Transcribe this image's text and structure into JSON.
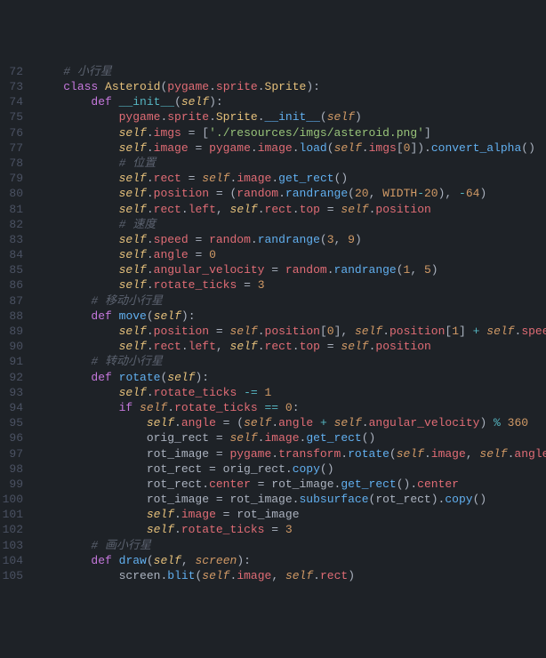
{
  "startLine": 72,
  "lines": [
    [
      [
        "    ",
        ""
      ],
      [
        "# 小行星",
        "c-comment"
      ]
    ],
    [
      [
        "    ",
        ""
      ],
      [
        "class ",
        "c-keyword"
      ],
      [
        "Asteroid",
        "c-class"
      ],
      [
        "(",
        "c-punct"
      ],
      [
        "pygame",
        "c-prop"
      ],
      [
        ".",
        "c-punct"
      ],
      [
        "sprite",
        "c-prop"
      ],
      [
        ".",
        "c-punct"
      ],
      [
        "Sprite",
        "c-class"
      ],
      [
        "):",
        "c-punct"
      ]
    ],
    [
      [
        "        ",
        ""
      ],
      [
        "def ",
        "c-keyword"
      ],
      [
        "__init__",
        "c-special"
      ],
      [
        "(",
        "c-punct"
      ],
      [
        "self",
        "c-self"
      ],
      [
        "):",
        "c-punct"
      ]
    ],
    [
      [
        "            ",
        ""
      ],
      [
        "pygame",
        "c-prop"
      ],
      [
        ".",
        "c-punct"
      ],
      [
        "sprite",
        "c-prop"
      ],
      [
        ".",
        "c-punct"
      ],
      [
        "Sprite",
        "c-class"
      ],
      [
        ".",
        "c-punct"
      ],
      [
        "__init__",
        "c-func"
      ],
      [
        "(",
        "c-punct"
      ],
      [
        "self",
        "c-param"
      ],
      [
        ")",
        "c-punct"
      ]
    ],
    [
      [
        "            ",
        ""
      ],
      [
        "self",
        "c-self"
      ],
      [
        ".",
        "c-punct"
      ],
      [
        "imgs",
        "c-prop"
      ],
      [
        " = ",
        "c-punct"
      ],
      [
        "[",
        "c-punct"
      ],
      [
        "'./resources/imgs/asteroid.png'",
        "c-string"
      ],
      [
        "]",
        "c-punct"
      ]
    ],
    [
      [
        "            ",
        ""
      ],
      [
        "self",
        "c-self"
      ],
      [
        ".",
        "c-punct"
      ],
      [
        "image",
        "c-prop"
      ],
      [
        " = ",
        "c-punct"
      ],
      [
        "pygame",
        "c-prop"
      ],
      [
        ".",
        "c-punct"
      ],
      [
        "image",
        "c-prop"
      ],
      [
        ".",
        "c-punct"
      ],
      [
        "load",
        "c-func"
      ],
      [
        "(",
        "c-punct"
      ],
      [
        "self",
        "c-param"
      ],
      [
        ".",
        "c-punct"
      ],
      [
        "imgs",
        "c-prop"
      ],
      [
        "[",
        "c-punct"
      ],
      [
        "0",
        "c-num"
      ],
      [
        "]).",
        "c-punct"
      ],
      [
        "convert_alpha",
        "c-func"
      ],
      [
        "()",
        "c-punct"
      ]
    ],
    [
      [
        "            ",
        ""
      ],
      [
        "# 位置",
        "c-comment"
      ]
    ],
    [
      [
        "            ",
        ""
      ],
      [
        "self",
        "c-self"
      ],
      [
        ".",
        "c-punct"
      ],
      [
        "rect",
        "c-prop"
      ],
      [
        " = ",
        "c-punct"
      ],
      [
        "self",
        "c-param"
      ],
      [
        ".",
        "c-punct"
      ],
      [
        "image",
        "c-prop"
      ],
      [
        ".",
        "c-punct"
      ],
      [
        "get_rect",
        "c-func"
      ],
      [
        "()",
        "c-punct"
      ]
    ],
    [
      [
        "            ",
        ""
      ],
      [
        "self",
        "c-self"
      ],
      [
        ".",
        "c-punct"
      ],
      [
        "position",
        "c-prop"
      ],
      [
        " = (",
        "c-punct"
      ],
      [
        "random",
        "c-prop"
      ],
      [
        ".",
        "c-punct"
      ],
      [
        "randrange",
        "c-func"
      ],
      [
        "(",
        "c-punct"
      ],
      [
        "20",
        "c-num"
      ],
      [
        ", ",
        "c-punct"
      ],
      [
        "WIDTH",
        "c-const"
      ],
      [
        "-",
        "c-op"
      ],
      [
        "20",
        "c-num"
      ],
      [
        "), ",
        "c-punct"
      ],
      [
        "-",
        "c-op"
      ],
      [
        "64",
        "c-num"
      ],
      [
        ")",
        "c-punct"
      ]
    ],
    [
      [
        "            ",
        ""
      ],
      [
        "self",
        "c-self"
      ],
      [
        ".",
        "c-punct"
      ],
      [
        "rect",
        "c-prop"
      ],
      [
        ".",
        "c-punct"
      ],
      [
        "left",
        "c-prop"
      ],
      [
        ", ",
        "c-punct"
      ],
      [
        "self",
        "c-self"
      ],
      [
        ".",
        "c-punct"
      ],
      [
        "rect",
        "c-prop"
      ],
      [
        ".",
        "c-punct"
      ],
      [
        "top",
        "c-prop"
      ],
      [
        " = ",
        "c-punct"
      ],
      [
        "self",
        "c-param"
      ],
      [
        ".",
        "c-punct"
      ],
      [
        "position",
        "c-prop"
      ]
    ],
    [
      [
        "            ",
        ""
      ],
      [
        "# 速度",
        "c-comment"
      ]
    ],
    [
      [
        "            ",
        ""
      ],
      [
        "self",
        "c-self"
      ],
      [
        ".",
        "c-punct"
      ],
      [
        "speed",
        "c-prop"
      ],
      [
        " = ",
        "c-punct"
      ],
      [
        "random",
        "c-prop"
      ],
      [
        ".",
        "c-punct"
      ],
      [
        "randrange",
        "c-func"
      ],
      [
        "(",
        "c-punct"
      ],
      [
        "3",
        "c-num"
      ],
      [
        ", ",
        "c-punct"
      ],
      [
        "9",
        "c-num"
      ],
      [
        ")",
        "c-punct"
      ]
    ],
    [
      [
        "            ",
        ""
      ],
      [
        "self",
        "c-self"
      ],
      [
        ".",
        "c-punct"
      ],
      [
        "angle",
        "c-prop"
      ],
      [
        " = ",
        "c-punct"
      ],
      [
        "0",
        "c-num"
      ]
    ],
    [
      [
        "            ",
        ""
      ],
      [
        "self",
        "c-self"
      ],
      [
        ".",
        "c-punct"
      ],
      [
        "angular_velocity",
        "c-prop"
      ],
      [
        " = ",
        "c-punct"
      ],
      [
        "random",
        "c-prop"
      ],
      [
        ".",
        "c-punct"
      ],
      [
        "randrange",
        "c-func"
      ],
      [
        "(",
        "c-punct"
      ],
      [
        "1",
        "c-num"
      ],
      [
        ", ",
        "c-punct"
      ],
      [
        "5",
        "c-num"
      ],
      [
        ")",
        "c-punct"
      ]
    ],
    [
      [
        "            ",
        ""
      ],
      [
        "self",
        "c-self"
      ],
      [
        ".",
        "c-punct"
      ],
      [
        "rotate_ticks",
        "c-prop"
      ],
      [
        " = ",
        "c-punct"
      ],
      [
        "3",
        "c-num"
      ]
    ],
    [
      [
        "        ",
        ""
      ],
      [
        "# 移动小行星",
        "c-comment"
      ]
    ],
    [
      [
        "        ",
        ""
      ],
      [
        "def ",
        "c-keyword"
      ],
      [
        "move",
        "c-func"
      ],
      [
        "(",
        "c-punct"
      ],
      [
        "self",
        "c-self"
      ],
      [
        "):",
        "c-punct"
      ]
    ],
    [
      [
        "            ",
        ""
      ],
      [
        "self",
        "c-self"
      ],
      [
        ".",
        "c-punct"
      ],
      [
        "position",
        "c-prop"
      ],
      [
        " = ",
        "c-punct"
      ],
      [
        "self",
        "c-param"
      ],
      [
        ".",
        "c-punct"
      ],
      [
        "position",
        "c-prop"
      ],
      [
        "[",
        "c-punct"
      ],
      [
        "0",
        "c-num"
      ],
      [
        "], ",
        "c-punct"
      ],
      [
        "self",
        "c-param"
      ],
      [
        ".",
        "c-punct"
      ],
      [
        "position",
        "c-prop"
      ],
      [
        "[",
        "c-punct"
      ],
      [
        "1",
        "c-num"
      ],
      [
        "] ",
        "c-punct"
      ],
      [
        "+",
        "c-op"
      ],
      [
        " ",
        "c-punct"
      ],
      [
        "self",
        "c-param"
      ],
      [
        ".",
        "c-punct"
      ],
      [
        "speed",
        "c-prop"
      ]
    ],
    [
      [
        "            ",
        ""
      ],
      [
        "self",
        "c-self"
      ],
      [
        ".",
        "c-punct"
      ],
      [
        "rect",
        "c-prop"
      ],
      [
        ".",
        "c-punct"
      ],
      [
        "left",
        "c-prop"
      ],
      [
        ", ",
        "c-punct"
      ],
      [
        "self",
        "c-self"
      ],
      [
        ".",
        "c-punct"
      ],
      [
        "rect",
        "c-prop"
      ],
      [
        ".",
        "c-punct"
      ],
      [
        "top",
        "c-prop"
      ],
      [
        " = ",
        "c-punct"
      ],
      [
        "self",
        "c-param"
      ],
      [
        ".",
        "c-punct"
      ],
      [
        "position",
        "c-prop"
      ]
    ],
    [
      [
        "        ",
        ""
      ],
      [
        "# 转动小行星",
        "c-comment"
      ]
    ],
    [
      [
        "        ",
        ""
      ],
      [
        "def ",
        "c-keyword"
      ],
      [
        "rotate",
        "c-func"
      ],
      [
        "(",
        "c-punct"
      ],
      [
        "self",
        "c-self"
      ],
      [
        "):",
        "c-punct"
      ]
    ],
    [
      [
        "            ",
        ""
      ],
      [
        "self",
        "c-self"
      ],
      [
        ".",
        "c-punct"
      ],
      [
        "rotate_ticks",
        "c-prop"
      ],
      [
        " ",
        "c-punct"
      ],
      [
        "-=",
        "c-op"
      ],
      [
        " ",
        "c-punct"
      ],
      [
        "1",
        "c-num"
      ]
    ],
    [
      [
        "            ",
        ""
      ],
      [
        "if ",
        "c-keyword"
      ],
      [
        "self",
        "c-param"
      ],
      [
        ".",
        "c-punct"
      ],
      [
        "rotate_ticks",
        "c-prop"
      ],
      [
        " ",
        "c-punct"
      ],
      [
        "==",
        "c-op"
      ],
      [
        " ",
        "c-punct"
      ],
      [
        "0",
        "c-num"
      ],
      [
        ":",
        "c-punct"
      ]
    ],
    [
      [
        "                ",
        ""
      ],
      [
        "self",
        "c-self"
      ],
      [
        ".",
        "c-punct"
      ],
      [
        "angle",
        "c-prop"
      ],
      [
        " = (",
        "c-punct"
      ],
      [
        "self",
        "c-param"
      ],
      [
        ".",
        "c-punct"
      ],
      [
        "angle",
        "c-prop"
      ],
      [
        " ",
        "c-punct"
      ],
      [
        "+",
        "c-op"
      ],
      [
        " ",
        "c-punct"
      ],
      [
        "self",
        "c-param"
      ],
      [
        ".",
        "c-punct"
      ],
      [
        "angular_velocity",
        "c-prop"
      ],
      [
        ") ",
        "c-punct"
      ],
      [
        "%",
        "c-op"
      ],
      [
        " ",
        "c-punct"
      ],
      [
        "360",
        "c-num"
      ]
    ],
    [
      [
        "                ",
        ""
      ],
      [
        "orig_rect ",
        "c-punct"
      ],
      [
        "= ",
        "c-punct"
      ],
      [
        "self",
        "c-param"
      ],
      [
        ".",
        "c-punct"
      ],
      [
        "image",
        "c-prop"
      ],
      [
        ".",
        "c-punct"
      ],
      [
        "get_rect",
        "c-func"
      ],
      [
        "()",
        "c-punct"
      ]
    ],
    [
      [
        "                ",
        ""
      ],
      [
        "rot_image ",
        "c-punct"
      ],
      [
        "= ",
        "c-punct"
      ],
      [
        "pygame",
        "c-prop"
      ],
      [
        ".",
        "c-punct"
      ],
      [
        "transform",
        "c-prop"
      ],
      [
        ".",
        "c-punct"
      ],
      [
        "rotate",
        "c-func"
      ],
      [
        "(",
        "c-punct"
      ],
      [
        "self",
        "c-param"
      ],
      [
        ".",
        "c-punct"
      ],
      [
        "image",
        "c-prop"
      ],
      [
        ", ",
        "c-punct"
      ],
      [
        "self",
        "c-param"
      ],
      [
        ".",
        "c-punct"
      ],
      [
        "angle",
        "c-prop"
      ],
      [
        ")",
        "c-punct"
      ]
    ],
    [
      [
        "                ",
        ""
      ],
      [
        "rot_rect ",
        "c-punct"
      ],
      [
        "= ",
        "c-punct"
      ],
      [
        "orig_rect",
        ""
      ],
      [
        ".",
        "c-punct"
      ],
      [
        "copy",
        "c-func"
      ],
      [
        "()",
        "c-punct"
      ]
    ],
    [
      [
        "                ",
        ""
      ],
      [
        "rot_rect",
        ""
      ],
      [
        ".",
        "c-punct"
      ],
      [
        "center",
        "c-prop"
      ],
      [
        " = ",
        "c-punct"
      ],
      [
        "rot_image",
        ""
      ],
      [
        ".",
        "c-punct"
      ],
      [
        "get_rect",
        "c-func"
      ],
      [
        "().",
        "c-punct"
      ],
      [
        "center",
        "c-prop"
      ]
    ],
    [
      [
        "                ",
        ""
      ],
      [
        "rot_image ",
        "c-punct"
      ],
      [
        "= ",
        "c-punct"
      ],
      [
        "rot_image",
        ""
      ],
      [
        ".",
        "c-punct"
      ],
      [
        "subsurface",
        "c-func"
      ],
      [
        "(",
        "c-punct"
      ],
      [
        "rot_rect",
        ""
      ],
      [
        ").",
        "c-punct"
      ],
      [
        "copy",
        "c-func"
      ],
      [
        "()",
        "c-punct"
      ]
    ],
    [
      [
        "                ",
        ""
      ],
      [
        "self",
        "c-self"
      ],
      [
        ".",
        "c-punct"
      ],
      [
        "image",
        "c-prop"
      ],
      [
        " = ",
        "c-punct"
      ],
      [
        "rot_image",
        "c-punct"
      ]
    ],
    [
      [
        "                ",
        ""
      ],
      [
        "self",
        "c-self"
      ],
      [
        ".",
        "c-punct"
      ],
      [
        "rotate_ticks",
        "c-prop"
      ],
      [
        " = ",
        "c-punct"
      ],
      [
        "3",
        "c-num"
      ]
    ],
    [
      [
        "        ",
        ""
      ],
      [
        "# 画小行星",
        "c-comment"
      ]
    ],
    [
      [
        "        ",
        ""
      ],
      [
        "def ",
        "c-keyword"
      ],
      [
        "draw",
        "c-func"
      ],
      [
        "(",
        "c-punct"
      ],
      [
        "self",
        "c-self"
      ],
      [
        ", ",
        "c-punct"
      ],
      [
        "screen",
        "c-param"
      ],
      [
        "):",
        "c-punct"
      ]
    ],
    [
      [
        "            ",
        ""
      ],
      [
        "screen",
        ""
      ],
      [
        ".",
        "c-punct"
      ],
      [
        "blit",
        "c-func"
      ],
      [
        "(",
        "c-punct"
      ],
      [
        "self",
        "c-param"
      ],
      [
        ".",
        "c-punct"
      ],
      [
        "image",
        "c-prop"
      ],
      [
        ", ",
        "c-punct"
      ],
      [
        "self",
        "c-param"
      ],
      [
        ".",
        "c-punct"
      ],
      [
        "rect",
        "c-prop"
      ],
      [
        ")",
        "c-punct"
      ]
    ]
  ]
}
